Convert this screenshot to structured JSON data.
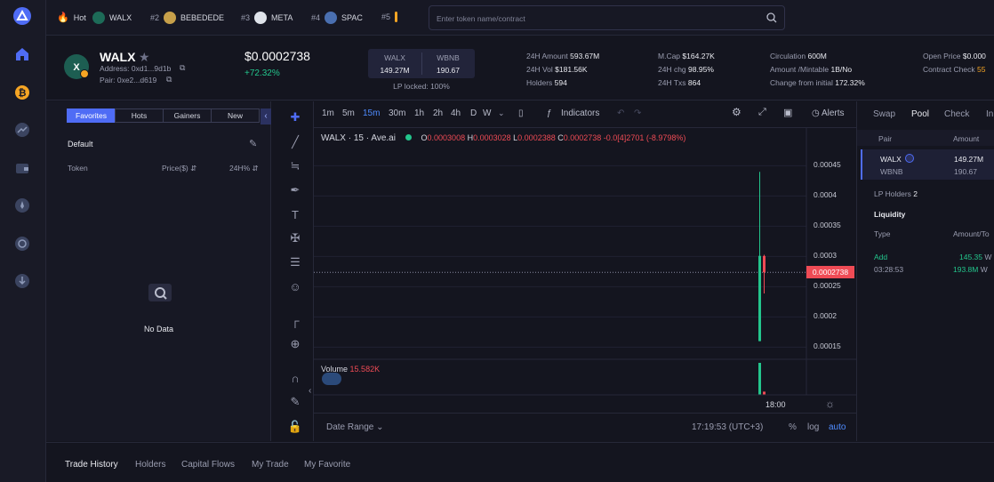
{
  "topbar": {
    "hot_label": "Hot",
    "items": [
      {
        "rank": "",
        "name": "WALX"
      },
      {
        "rank": "#2",
        "name": "BEBEDEDE"
      },
      {
        "rank": "#3",
        "name": "META"
      },
      {
        "rank": "#4",
        "name": "SPAC"
      },
      {
        "rank": "#5",
        "name": ""
      }
    ],
    "search_placeholder": "Enter token name/contract"
  },
  "token": {
    "symbol": "WALX",
    "address": "Address: 0xd1...9d1b",
    "pair": "Pair: 0xe2...d619",
    "price": "$0.0002738",
    "change": "+72.32%"
  },
  "pool_box": {
    "base": "WALX",
    "base_amount": "149.27M",
    "quote": "WBNB",
    "quote_amount": "190.67",
    "lp_locked": "LP locked: 100%"
  },
  "stats": {
    "col1": [
      {
        "label": "24H Amount",
        "value": "593.67M"
      },
      {
        "label": "24H Vol",
        "value": "$181.56K"
      },
      {
        "label": "Holders",
        "value": "594"
      }
    ],
    "col2": [
      {
        "label": "M.Cap",
        "value": "$164.27K"
      },
      {
        "label": "24H chg",
        "value": "98.95%"
      },
      {
        "label": "24H Txs",
        "value": "864"
      }
    ],
    "col3": [
      {
        "label": "Circulation",
        "value": "600M"
      },
      {
        "label": "Amount /Mintable",
        "value": "1B/No"
      },
      {
        "label": "Change from initial",
        "value": "172.32%"
      }
    ],
    "col4": [
      {
        "label": "Open Price",
        "value": "$0.000"
      },
      {
        "label": "Contract Check",
        "value": "55"
      }
    ]
  },
  "left_panel": {
    "tabs": [
      "Favorites",
      "Hots",
      "Gainers",
      "New"
    ],
    "group": "Default",
    "columns": [
      "Token",
      "Price($)",
      "24H%"
    ],
    "empty_text": "No Data"
  },
  "chart_header": {
    "timeframes": [
      "1m",
      "5m",
      "15m",
      "30m",
      "1h",
      "2h",
      "4h",
      "D",
      "W"
    ],
    "indicators": "Indicators",
    "alerts": "Alerts",
    "legend_symbol": "WALX",
    "legend_interval": "15",
    "legend_source": "Ave.ai",
    "ohlc": {
      "o_label": "O",
      "o": "0.0003008",
      "h_label": "H",
      "h": "0.0003028",
      "l_label": "L",
      "l": "0.0002388",
      "c_label": "C",
      "c": "0.0002738",
      "change": "-0.0[4]2701 (-8.9798%)"
    },
    "volume_label": "Volume",
    "volume_value": "15.582K"
  },
  "chart_data": {
    "type": "candlestick",
    "y_ticks": [
      "0.00045",
      "0.0004",
      "0.00035",
      "0.0003",
      "0.00025",
      "0.0002",
      "0.00015"
    ],
    "ylim": [
      0.00013,
      0.00048
    ],
    "x_ticks": [
      "18:00"
    ],
    "current_price_label": "0.0002738",
    "candles": [
      {
        "o": 0.00016,
        "h": 0.00044,
        "l": 0.00016,
        "c": 0.000301,
        "color": "#23c58c"
      },
      {
        "o": 0.0003008,
        "h": 0.0003028,
        "l": 0.0002388,
        "c": 0.0002738,
        "color": "#ef4b55"
      }
    ],
    "volume": [
      1.0,
      0.1
    ]
  },
  "chart_footer": {
    "date_range": "Date Range",
    "time": "17:19:53 (UTC+3)",
    "percent": "%",
    "log": "log",
    "auto": "auto"
  },
  "right_panel": {
    "tabs": [
      "Swap",
      "Pool",
      "Check",
      "In"
    ],
    "columns": [
      "Pair",
      "Amount"
    ],
    "pair_rows": [
      {
        "token": "WALX",
        "amount": "149.27M"
      },
      {
        "token": "WBNB",
        "amount": "190.67"
      }
    ],
    "lp_holders_label": "LP Holders",
    "lp_holders_value": "2",
    "liquidity_label": "Liquidity",
    "liq_columns": [
      "Type",
      "Amount/To"
    ],
    "liq_row": {
      "type": "Add",
      "time": "03:28:53",
      "amount1": "145.35",
      "amount2": "193.8M",
      "unit": "W"
    }
  },
  "bottom_tabs": [
    "Trade History",
    "Holders",
    "Capital Flows",
    "My Trade",
    "My Favorite"
  ]
}
